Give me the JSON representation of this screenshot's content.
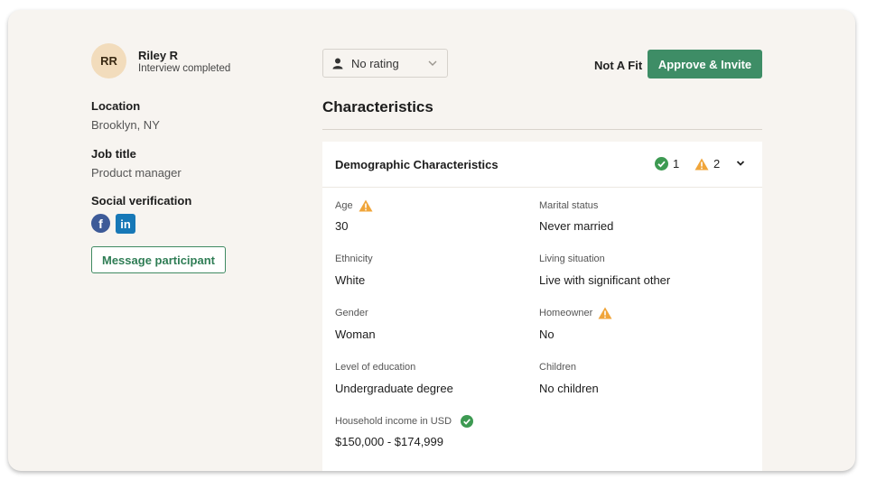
{
  "participant": {
    "initials": "RR",
    "name": "Riley R",
    "status": "Interview completed"
  },
  "details": {
    "location_label": "Location",
    "location_value": "Brooklyn, NY",
    "job_label": "Job title",
    "job_value": "Product manager",
    "social_label": "Social verification"
  },
  "social_icons": [
    "facebook-icon",
    "linkedin-icon"
  ],
  "message_button": "Message participant",
  "header": {
    "rating_value": "No rating",
    "not_fit_label": "Not A Fit",
    "approve_label": "Approve & Invite"
  },
  "section_title": "Characteristics",
  "demographic": {
    "title": "Demographic Characteristics",
    "verified_count": "1",
    "warning_count": "2",
    "fields": {
      "age": {
        "label": "Age",
        "value": "30",
        "flag": "warning"
      },
      "marital": {
        "label": "Marital status",
        "value": "Never married"
      },
      "ethnicity": {
        "label": "Ethnicity",
        "value": "White"
      },
      "living": {
        "label": "Living situation",
        "value": "Live with significant other"
      },
      "gender": {
        "label": "Gender",
        "value": "Woman"
      },
      "homeowner": {
        "label": "Homeowner",
        "value": "No",
        "flag": "warning"
      },
      "education": {
        "label": "Level of education",
        "value": "Undergraduate degree"
      },
      "children": {
        "label": "Children",
        "value": "No children"
      },
      "income": {
        "label": "Household income in USD",
        "value": "$150,000 - $174,999",
        "flag": "verified"
      }
    }
  },
  "colors": {
    "accent_green": "#3e8d66",
    "warning_orange": "#f0a53a",
    "verified_green": "#3d9a52",
    "avatar_bg": "#f2dcbc",
    "card_bg": "#f7f4f0"
  }
}
